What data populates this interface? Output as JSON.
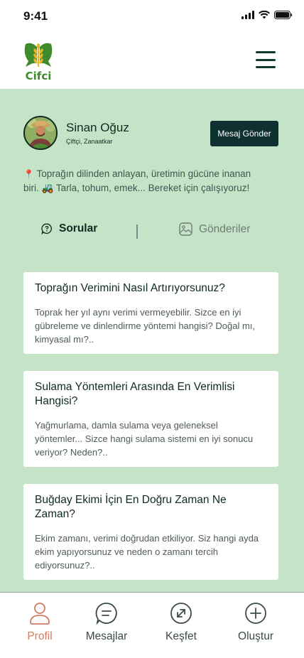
{
  "status_bar": {
    "time": "9:41"
  },
  "header": {
    "logo_text": "Cifci"
  },
  "profile": {
    "name": "Sinan Oğuz",
    "role": "Çiftçi, Zanaatkar",
    "message_button": "Mesaj Gönder",
    "bio_line1": "Toprağın dilinden anlayan, üretimin gücüne inanan",
    "bio_line2_pre": "biri.",
    "bio_line2_post": "Tarla, tohum, emek... Bereket için çalışıyoruz!"
  },
  "tabs": [
    {
      "label": "Sorular",
      "active": true
    },
    {
      "label": "Gönderiler",
      "active": false
    }
  ],
  "questions": [
    {
      "title": "Toprağın Verimini Nasıl Artırıyorsunuz?",
      "body": "Toprak her yıl aynı verimi vermeyebilir. Sizce en iyi gübreleme ve dinlendirme yöntemi hangisi? Doğal mı, kimyasal mı?.."
    },
    {
      "title": "Sulama Yöntemleri Arasında En Verimlisi Hangisi?",
      "body": "Yağmurlama, damla sulama veya geleneksel yöntemler... Sizce hangi sulama sistemi en iyi sonucu veriyor? Neden?.."
    },
    {
      "title": "Buğday Ekimi İçin En Doğru Zaman Ne Zaman?",
      "body": "Ekim zamanı, verimi doğrudan etkiliyor. Siz hangi ayda ekim yapıyorsunuz ve neden o zamanı tercih ediyorsunuz?.."
    }
  ],
  "bottom_nav": [
    {
      "label": "Profil",
      "icon": "user-icon",
      "active": true
    },
    {
      "label": "Mesajlar",
      "icon": "chat-icon",
      "active": false
    },
    {
      "label": "Keşfet",
      "icon": "compass-icon",
      "active": false
    },
    {
      "label": "Oluştur",
      "icon": "plus-circle-icon",
      "active": false
    }
  ],
  "colors": {
    "background_green": "#c5e3c6",
    "dark_teal": "#0f3030",
    "active_nav": "#d07d63",
    "logo_green": "#3f8a2a",
    "logo_yellow": "#e7b52c"
  }
}
